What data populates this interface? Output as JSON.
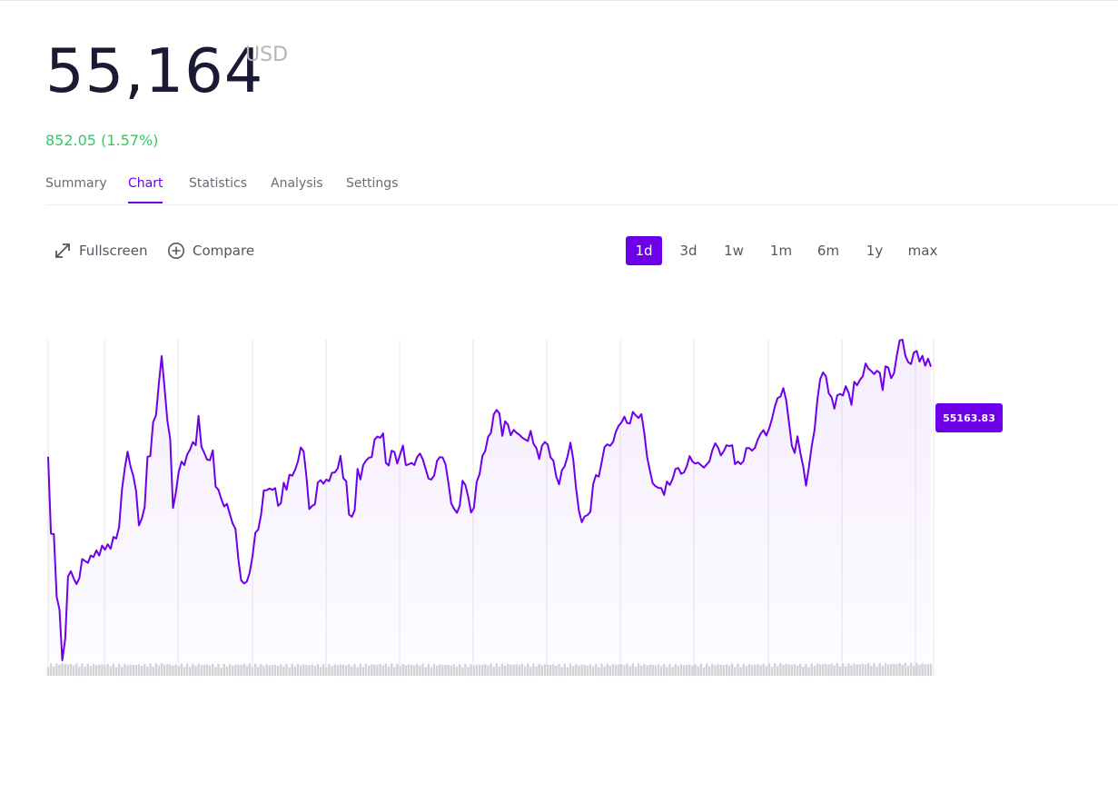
{
  "header": {
    "price": "55,164",
    "currency": "USD",
    "change": "852.05 (1.57%)",
    "change_color": "#2dcb62"
  },
  "tabs": [
    {
      "label": "Summary",
      "active": false
    },
    {
      "label": "Chart",
      "active": true
    },
    {
      "label": "Statistics",
      "active": false
    },
    {
      "label": "Analysis",
      "active": false
    },
    {
      "label": "Settings",
      "active": false
    }
  ],
  "toolbar": {
    "fullscreen_label": "Fullscreen",
    "fullscreen_icon": "expand-arrows-icon",
    "compare_label": "Compare",
    "compare_icon": "plus-circle-icon"
  },
  "ranges": [
    {
      "label": "1d",
      "active": true
    },
    {
      "label": "3d",
      "active": false
    },
    {
      "label": "1w",
      "active": false
    },
    {
      "label": "1m",
      "active": false
    },
    {
      "label": "6m",
      "active": false
    },
    {
      "label": "1y",
      "active": false
    },
    {
      "label": "max",
      "active": false
    }
  ],
  "colors": {
    "accent": "#6d00e8",
    "text_dark": "#1a1b33",
    "muted": "#b5b5bd",
    "gridline": "#e5e5ea",
    "volume": "#d4d4d8"
  },
  "chart_data": {
    "type": "area",
    "grid": "vertical lines only",
    "axes_visible": false,
    "last_value_label": "55163.83",
    "series": [
      {
        "values": [
          0.635,
          0.395,
          0.394,
          0.199,
          0.158,
          0.0,
          0.067,
          0.262,
          0.278,
          0.256,
          0.238,
          0.257,
          0.316,
          0.31,
          0.304,
          0.327,
          0.322,
          0.343,
          0.327,
          0.358,
          0.345,
          0.362,
          0.348,
          0.385,
          0.38,
          0.415,
          0.533,
          0.599,
          0.651,
          0.606,
          0.575,
          0.527,
          0.421,
          0.442,
          0.478,
          0.635,
          0.637,
          0.743,
          0.765,
          0.863,
          0.949,
          0.853,
          0.748,
          0.69,
          0.475,
          0.523,
          0.589,
          0.62,
          0.609,
          0.642,
          0.658,
          0.681,
          0.671,
          0.763,
          0.666,
          0.647,
          0.626,
          0.624,
          0.655,
          0.542,
          0.532,
          0.504,
          0.48,
          0.488,
          0.457,
          0.427,
          0.41,
          0.317,
          0.25,
          0.24,
          0.246,
          0.274,
          0.324,
          0.398,
          0.408,
          0.453,
          0.53,
          0.531,
          0.536,
          0.532,
          0.537,
          0.482,
          0.49,
          0.554,
          0.532,
          0.579,
          0.576,
          0.594,
          0.62,
          0.664,
          0.652,
          0.574,
          0.472,
          0.482,
          0.487,
          0.555,
          0.562,
          0.551,
          0.564,
          0.559,
          0.585,
          0.586,
          0.599,
          0.638,
          0.568,
          0.559,
          0.455,
          0.448,
          0.468,
          0.597,
          0.564,
          0.609,
          0.623,
          0.632,
          0.634,
          0.688,
          0.698,
          0.694,
          0.708,
          0.616,
          0.608,
          0.654,
          0.65,
          0.614,
          0.642,
          0.67,
          0.609,
          0.611,
          0.616,
          0.609,
          0.634,
          0.645,
          0.627,
          0.597,
          0.567,
          0.564,
          0.577,
          0.622,
          0.634,
          0.633,
          0.611,
          0.554,
          0.49,
          0.473,
          0.46,
          0.482,
          0.56,
          0.547,
          0.509,
          0.461,
          0.476,
          0.557,
          0.581,
          0.638,
          0.653,
          0.697,
          0.71,
          0.767,
          0.781,
          0.77,
          0.7,
          0.746,
          0.735,
          0.702,
          0.719,
          0.71,
          0.704,
          0.695,
          0.689,
          0.684,
          0.716,
          0.676,
          0.662,
          0.628,
          0.67,
          0.681,
          0.673,
          0.633,
          0.623,
          0.574,
          0.549,
          0.593,
          0.606,
          0.636,
          0.679,
          0.627,
          0.536,
          0.466,
          0.431,
          0.449,
          0.453,
          0.463,
          0.55,
          0.578,
          0.573,
          0.618,
          0.665,
          0.674,
          0.669,
          0.681,
          0.713,
          0.732,
          0.742,
          0.76,
          0.74,
          0.739,
          0.775,
          0.764,
          0.756,
          0.768,
          0.712,
          0.634,
          0.592,
          0.552,
          0.543,
          0.538,
          0.537,
          0.516,
          0.558,
          0.547,
          0.566,
          0.597,
          0.6,
          0.582,
          0.586,
          0.605,
          0.637,
          0.62,
          0.614,
          0.617,
          0.609,
          0.601,
          0.611,
          0.621,
          0.655,
          0.677,
          0.664,
          0.639,
          0.652,
          0.671,
          0.668,
          0.671,
          0.612,
          0.62,
          0.612,
          0.622,
          0.662,
          0.662,
          0.654,
          0.663,
          0.689,
          0.707,
          0.718,
          0.701,
          0.723,
          0.753,
          0.791,
          0.818,
          0.823,
          0.849,
          0.813,
          0.743,
          0.669,
          0.647,
          0.699,
          0.648,
          0.605,
          0.545,
          0.601,
          0.667,
          0.719,
          0.813,
          0.877,
          0.898,
          0.886,
          0.833,
          0.821,
          0.785,
          0.827,
          0.831,
          0.826,
          0.855,
          0.835,
          0.797,
          0.869,
          0.858,
          0.875,
          0.886,
          0.926,
          0.91,
          0.902,
          0.893,
          0.903,
          0.897,
          0.843,
          0.917,
          0.913,
          0.88,
          0.896,
          0.951,
          0.998,
          1.0,
          0.95,
          0.93,
          0.924,
          0.96,
          0.965,
          0.932,
          0.95,
          0.919,
          0.941,
          0.916
        ]
      }
    ]
  }
}
